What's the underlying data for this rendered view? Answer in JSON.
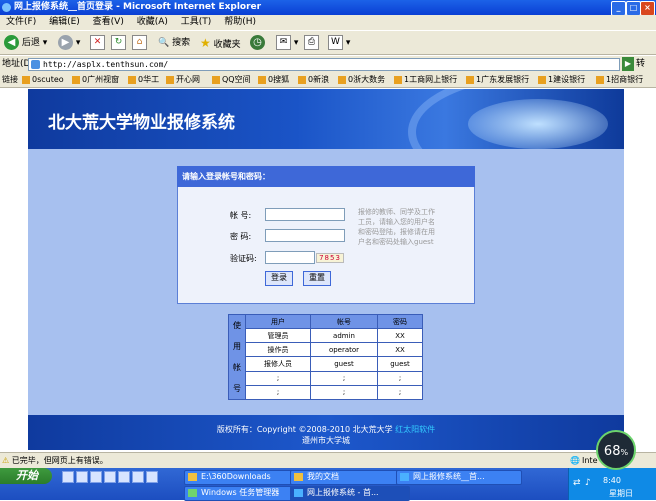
{
  "window": {
    "title": "网上报修系统__首页登录 - Microsoft Internet Explorer"
  },
  "menu": [
    "文件(F)",
    "编辑(E)",
    "查看(V)",
    "收藏(A)",
    "工具(T)",
    "帮助(H)"
  ],
  "toolbar": {
    "back": "后退",
    "search": "搜索",
    "favorites": "收藏夹"
  },
  "address": {
    "label": "地址(D)",
    "url": "http://asplx.tenthsun.com/"
  },
  "links": {
    "label": "链接",
    "items": [
      "0scuteo",
      "0广州视窗",
      "0华工",
      "开心网",
      "QQ空间",
      "0搜狐",
      "0新浪",
      "0浙大数务",
      "1工商网上银行",
      "1广东发展银行",
      "1建设银行",
      "1招商银行"
    ]
  },
  "site": {
    "title": "北大荒大学物业报修系统"
  },
  "login": {
    "header": "请输入登录帐号和密码：",
    "account_label": "帐  号:",
    "password_label": "密  码:",
    "captcha_label": "验证码:",
    "captcha_value": "7853",
    "hint": "报修的教师、同学及工作工员，请输入您的用户名和密码登陆，报修请在用户名和密码处输入guest",
    "login_button": "登录",
    "reset_button": "重置"
  },
  "users_table": {
    "side_label": [
      "使",
      "用",
      "帐",
      "号"
    ],
    "headers": [
      "用户",
      "帐号",
      "密码"
    ],
    "rows": [
      [
        "管理员",
        "admin",
        "XX"
      ],
      [
        "操作员",
        "operator",
        "XX"
      ],
      [
        "报修人员",
        "guest",
        "guest"
      ],
      [
        ";",
        ";",
        ";"
      ],
      [
        ";",
        ";",
        ";"
      ]
    ]
  },
  "footer": {
    "copyright": "版权所有：Copyright ©2008-2010 北大荒大学",
    "link": "红太阳软件",
    "line2": "遵州市大学城"
  },
  "status": {
    "text": "已完毕，但网页上有错误。",
    "zone": "Inte"
  },
  "taskbar": {
    "start": "开始",
    "tasks": [
      "E:\\360Downloads",
      "我的文档",
      "网上报修系统__首...",
      "Windows 任务管理器",
      "网上报修系统 - 首..."
    ],
    "clock": "8:40",
    "day": "星期日"
  },
  "gauge": {
    "value": "68",
    "unit": "%"
  }
}
